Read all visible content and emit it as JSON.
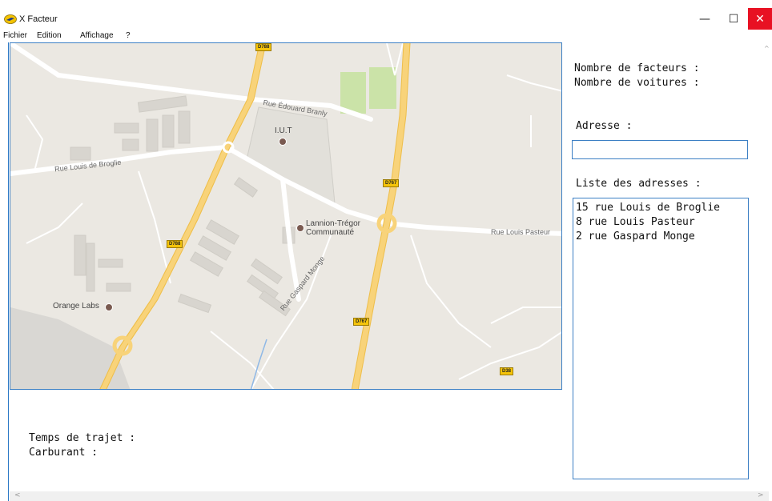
{
  "window": {
    "title": "X Facteur",
    "controls": {
      "minimize": "—",
      "maximize": "☐",
      "close": "✕"
    },
    "close_color": "#e81123"
  },
  "menu": {
    "items": [
      "Fichier",
      "Edition",
      "Affichage",
      "?"
    ]
  },
  "map": {
    "labels": {
      "rue_branly": "Rue Édouard Branly",
      "rue_broglie": "Rue Louis de Broglie",
      "rue_pasteur": "Rue Louis Pasteur",
      "rue_monge": "Rue Gaspard Monge",
      "iut": "I.U.T",
      "lannion": "Lannion-Trégor\nCommunauté",
      "orange": "Orange Labs"
    },
    "shields": {
      "d788_top": "D788",
      "d788_mid": "D788",
      "d767_top": "D767",
      "d767_bottom": "D767",
      "d38": "D38"
    }
  },
  "panel": {
    "nb_facteurs_label": "Nombre de facteurs :",
    "nb_voitures_label": "Nombre de voitures :",
    "adresse_label": "Adresse :",
    "adresse_value": "",
    "liste_label": "Liste des adresses :",
    "addresses": [
      "15 rue Louis de Broglie",
      "8 rue Louis Pasteur",
      "2 rue Gaspard Monge"
    ]
  },
  "footer": {
    "temps_label": "Temps de trajet :",
    "carburant_label": "Carburant :"
  },
  "scroll": {
    "left": "<",
    "right": ">",
    "up": "^"
  }
}
